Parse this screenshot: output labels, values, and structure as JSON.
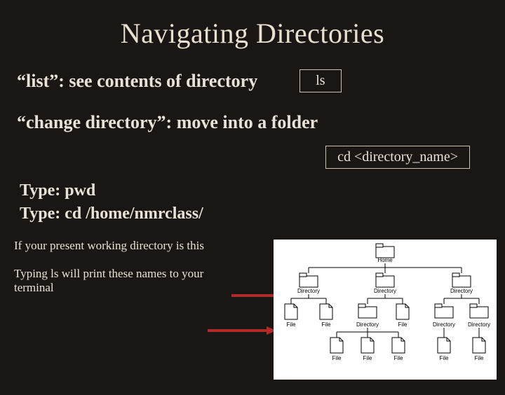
{
  "title": "Navigating Directories",
  "row1": {
    "label": "“list”:  see contents of directory",
    "cmd": "ls"
  },
  "row2": {
    "label": "“change directory”:  move into a folder",
    "cmd": "cd  <directory_name>"
  },
  "type1": "Type: pwd",
  "type2": "Type: cd /home/nmrclass/",
  "note1": "If your present working directory is this",
  "note2": "Typing ls will print these names to your terminal",
  "diagram": {
    "root": "Home",
    "level1": [
      "Directory",
      "Directory",
      "Directory"
    ],
    "level2": [
      "File",
      "File",
      "Directory",
      "File",
      "Directory",
      "Directory"
    ],
    "level3": [
      "File",
      "File",
      "File",
      "File",
      "File"
    ]
  }
}
